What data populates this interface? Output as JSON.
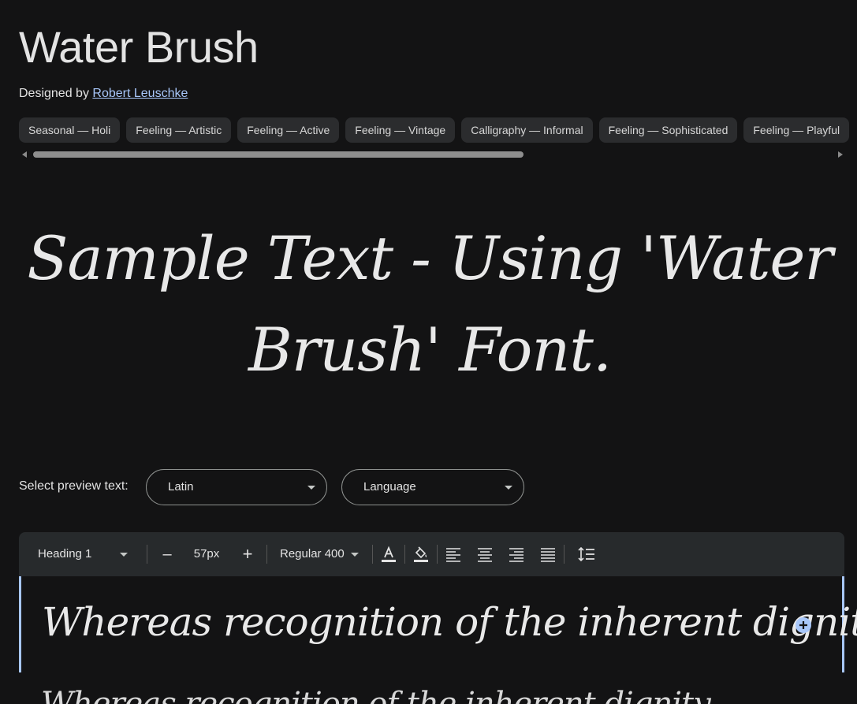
{
  "header": {
    "title": "Water Brush",
    "designed_by_prefix": "Designed by",
    "designer_name": "Robert Leuschke"
  },
  "tags": [
    "Seasonal — Holi",
    "Feeling — Artistic",
    "Feeling — Active",
    "Feeling — Vintage",
    "Calligraphy — Informal",
    "Feeling — Sophisticated",
    "Feeling — Playful"
  ],
  "sample": {
    "text": "Sample Text - Using 'Water Brush' Font."
  },
  "preview": {
    "label": "Select preview text:",
    "script_select": "Latin",
    "language_select": "Language"
  },
  "toolbar": {
    "style_select": "Heading 1",
    "decrease_label": "–",
    "size_value": "57px",
    "increase_label": "+",
    "weight_select": "Regular 400"
  },
  "editor": {
    "line1": "Whereas recognition of the inherent dignity",
    "line2": "Whereas recognition of the inherent dignity"
  },
  "colors": {
    "background": "#131314",
    "accent": "#a8c7fa",
    "chip": "#2b2c2e",
    "toolbar": "#272a2c"
  }
}
